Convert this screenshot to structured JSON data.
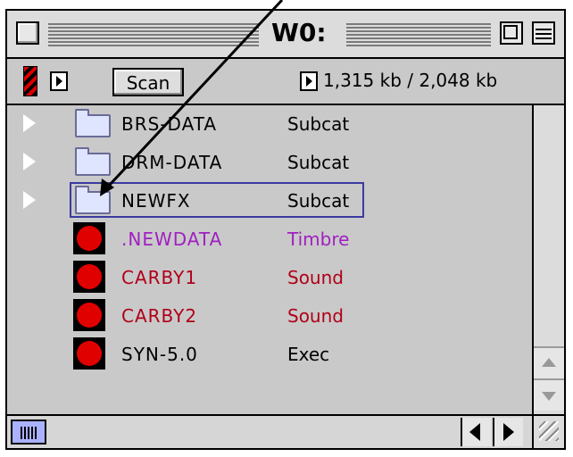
{
  "window": {
    "title": "W0:"
  },
  "toolbar": {
    "scan_label": "Scan",
    "size_text": "1,315 kb / 2,048 kb"
  },
  "files": [
    {
      "name": "BRS-DATA",
      "kind": "Subcat",
      "type": "folder",
      "color": "#000000"
    },
    {
      "name": "DRM-DATA",
      "kind": "Subcat",
      "type": "folder",
      "color": "#000000"
    },
    {
      "name": "NEWFX",
      "kind": "Subcat",
      "type": "folder",
      "color": "#000000",
      "selected": true
    },
    {
      "name": ".NEWDATA",
      "kind": "Timbre",
      "type": "file",
      "color": "#a020c0"
    },
    {
      "name": "CARBY1",
      "kind": "Sound",
      "type": "file",
      "color": "#b00018"
    },
    {
      "name": "CARBY2",
      "kind": "Sound",
      "type": "file",
      "color": "#b00018"
    },
    {
      "name": "SYN-5.0",
      "kind": "Exec",
      "type": "file",
      "color": "#000000"
    }
  ],
  "icons": {
    "folder": "folder-icon",
    "file": "red-circle-file-icon",
    "expand": "disclosure-triangle-icon"
  }
}
